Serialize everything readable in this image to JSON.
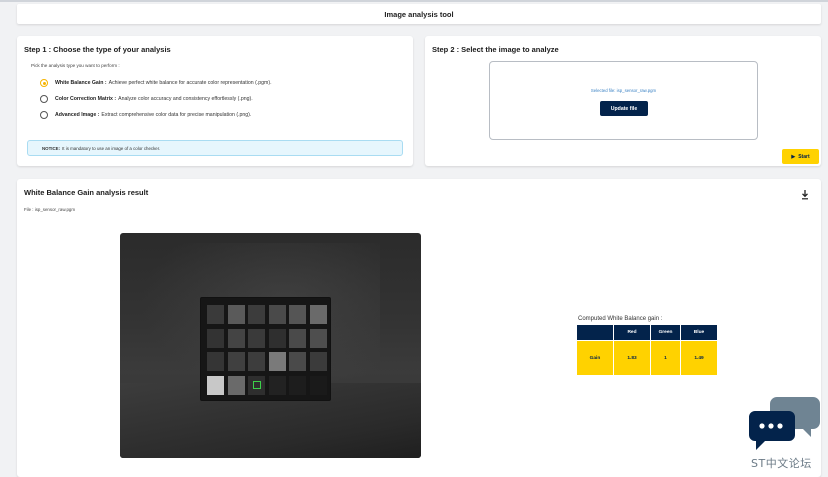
{
  "app": {
    "title": "Image analysis tool"
  },
  "step1": {
    "title": "Step 1 : Choose the type of your analysis",
    "instruction": "Pick the analysis type you want to perform :",
    "options": [
      {
        "name": "White Balance Gain :",
        "description": "Achieve perfect white balance for accurate color representation (.pgm).",
        "selected": true
      },
      {
        "name": "Color Correction Matrix :",
        "description": "Analyze color accuracy and consistency effortlessly (.png).",
        "selected": false
      },
      {
        "name": "Advanced Image :",
        "description": "Extract comprehensive color data for precise manipulation (.png).",
        "selected": false
      }
    ],
    "notice_label": "NOTICE:",
    "notice_text": "It is mandatory to use an image of a color checker."
  },
  "step2": {
    "title": "Step 2 : Select the image to analyze",
    "selected_file": "Selected file: isp_sensor_raw.pgm",
    "update_label": "Update file",
    "start_label": "Start"
  },
  "result": {
    "title": "White Balance Gain analysis result",
    "file_label": "File : isp_sensor_raw.pgm",
    "gain_title": "Computed White Balance gain :",
    "table": {
      "headers": [
        "",
        "Red",
        "Green",
        "Blue"
      ],
      "row": [
        "Gain",
        "1.83",
        "1",
        "1.49"
      ]
    }
  },
  "watermark": {
    "text": "ST中文论坛"
  },
  "colors": {
    "accent": "#ffd200",
    "navy": "#03234b",
    "radio_selected": "#f6b400",
    "notice_bg": "#e6f6fd",
    "link": "#3b82c4"
  },
  "icons": {
    "download": "download-icon",
    "play": "play-icon",
    "logo": "chat-bubbles-logo"
  }
}
